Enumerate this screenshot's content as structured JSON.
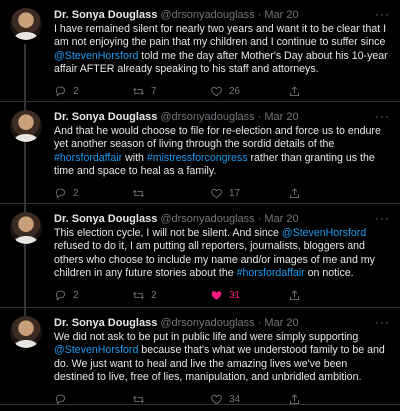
{
  "author": {
    "name": "Dr. Sonya Douglass",
    "handle": "@drsonyadouglass",
    "separator": "·"
  },
  "tweets": [
    {
      "time": "Mar 20",
      "segments": [
        {
          "text": "I have remained silent for nearly two years and want it to be clear that I am not enjoying the pain that my children and I continue to suffer since ",
          "link": false
        },
        {
          "text": "@StevenHorsford",
          "link": true
        },
        {
          "text": " told me the day after Mother's Day about his 10-year affair AFTER already speaking to his staff and attorneys.",
          "link": false
        }
      ],
      "replies": "2",
      "retweets": "7",
      "likes": "26",
      "liked": false
    },
    {
      "time": "Mar 20",
      "segments": [
        {
          "text": "And that he would choose to file for re-election and force us to endure yet another season of living through the sordid details of the ",
          "link": false
        },
        {
          "text": "#horsfordaffair",
          "link": true
        },
        {
          "text": " with ",
          "link": false
        },
        {
          "text": "#mistressforcongress",
          "link": true
        },
        {
          "text": " rather than granting us the time and space to heal as a family.",
          "link": false
        }
      ],
      "replies": "2",
      "retweets": "",
      "likes": "17",
      "liked": false
    },
    {
      "time": "Mar 20",
      "segments": [
        {
          "text": "This election cycle, I will not be silent. And since ",
          "link": false
        },
        {
          "text": "@StevenHorsford",
          "link": true
        },
        {
          "text": " refused to do it, I am putting all reporters, journalists, bloggers and others who choose to include my name and/or images of me and my children in any future stories about the ",
          "link": false
        },
        {
          "text": "#horsfordaffair",
          "link": true
        },
        {
          "text": " on notice.",
          "link": false
        }
      ],
      "replies": "2",
      "retweets": "2",
      "likes": "31",
      "liked": true
    },
    {
      "time": "Mar 20",
      "segments": [
        {
          "text": "We did not ask to be put in public life and were simply supporting ",
          "link": false
        },
        {
          "text": "@StevenHorsford",
          "link": true
        },
        {
          "text": " because that's what we understood family to be and do. We just want to heal and live the amazing lives we've been destined to live, free of lies, manipulation, and unbridled ambition.",
          "link": false
        }
      ],
      "replies": "",
      "retweets": "",
      "likes": "34",
      "liked": false
    }
  ],
  "colors": {
    "background": "#000000",
    "text": "#e7e9ea",
    "muted": "#71767b",
    "link": "#1d9bf0",
    "like_active": "#f91880",
    "divider": "#2f3336"
  },
  "icons": [
    "avatar",
    "more-icon",
    "reply-icon",
    "retweet-icon",
    "like-icon",
    "share-icon"
  ]
}
